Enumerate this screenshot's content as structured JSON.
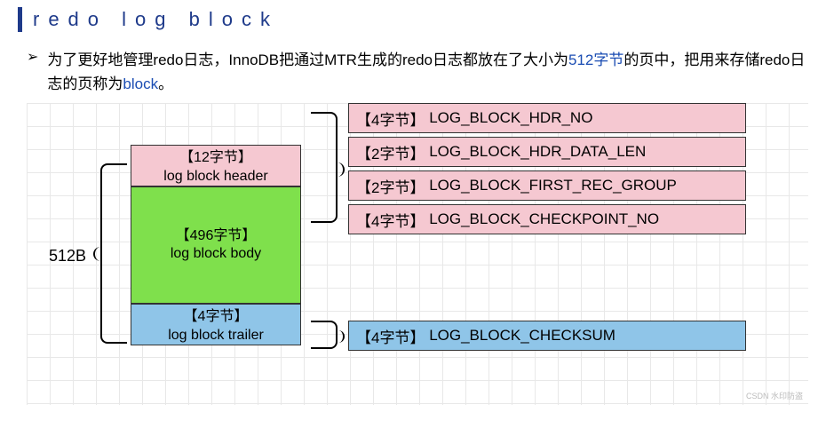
{
  "title": "redo log block",
  "bullet": "➢",
  "description": {
    "t1": "为了更好地管理redo日志，InnoDB把通过MTR生成的redo日志都放在了大小为",
    "t2": "512字节",
    "t3": "的页中，把用来存储redo日志的页称为",
    "t4": "block",
    "t5": "。"
  },
  "label512": "512B",
  "blocks": {
    "header": {
      "size": "【12字节】",
      "name": "log block header"
    },
    "body": {
      "size": "【496字节】",
      "name": "log block body"
    },
    "trailer": {
      "size": "【4字节】",
      "name": "log block trailer"
    }
  },
  "header_fields": [
    {
      "size": "【4字节】",
      "name": "LOG_BLOCK_HDR_NO"
    },
    {
      "size": "【2字节】",
      "name": "LOG_BLOCK_HDR_DATA_LEN"
    },
    {
      "size": "【2字节】",
      "name": "LOG_BLOCK_FIRST_REC_GROUP"
    },
    {
      "size": "【4字节】",
      "name": "LOG_BLOCK_CHECKPOINT_NO"
    }
  ],
  "trailer_field": {
    "size": "【4字节】",
    "name": "LOG_BLOCK_CHECKSUM"
  },
  "watermark": "CSDN 水印防盗"
}
